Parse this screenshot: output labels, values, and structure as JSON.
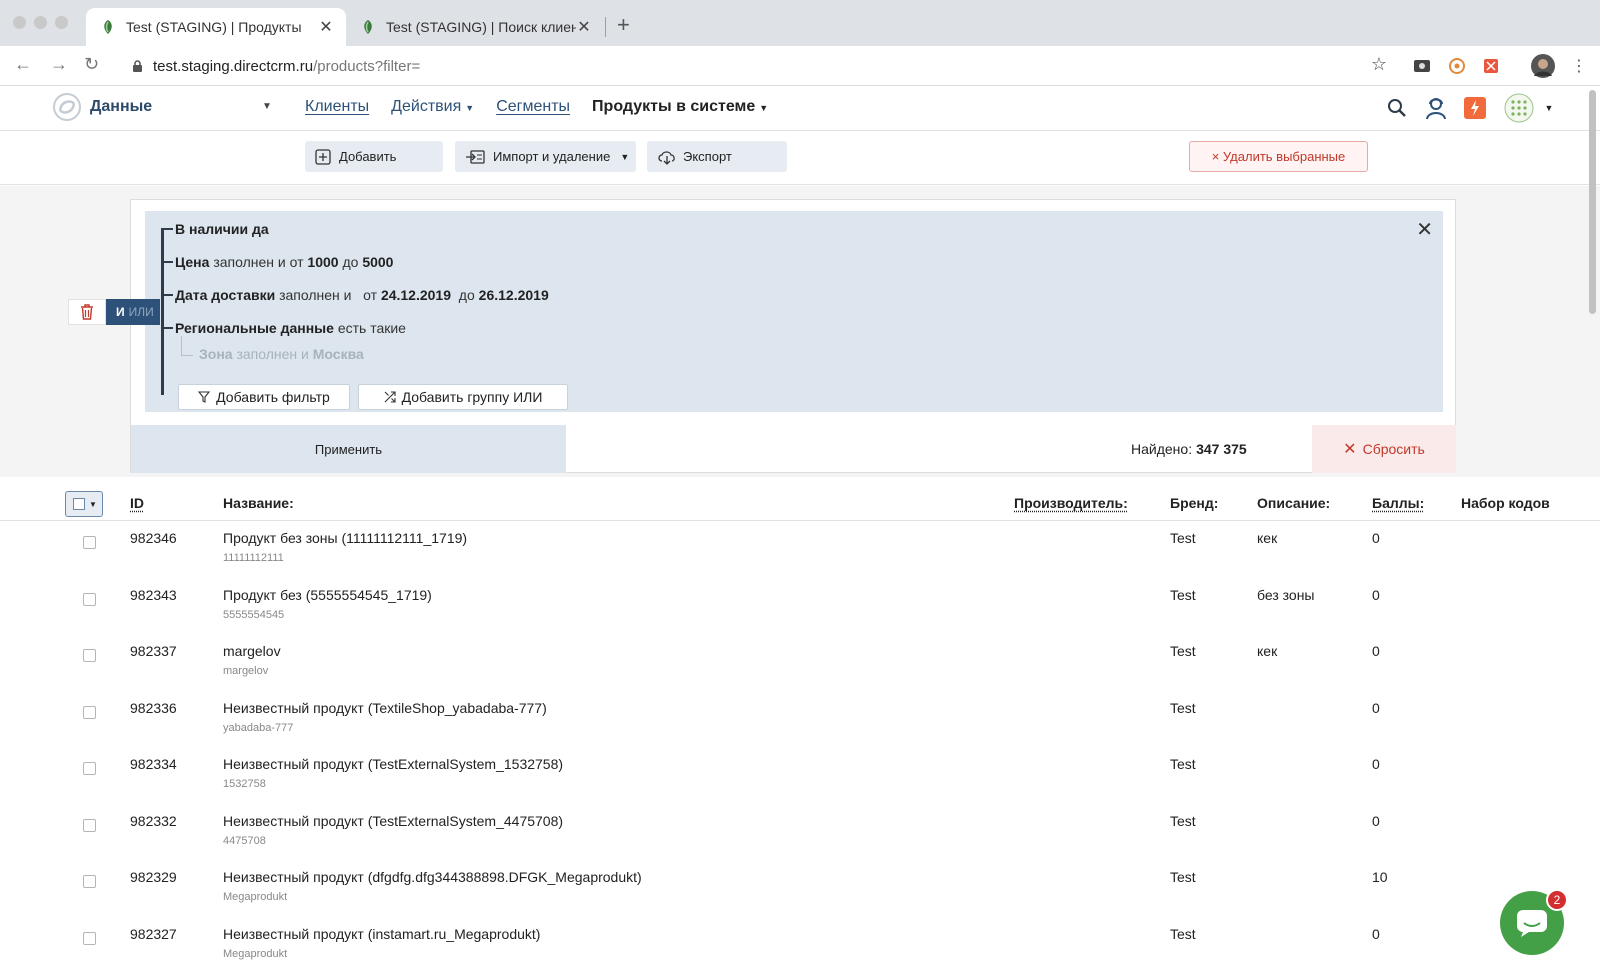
{
  "browser": {
    "tabs": [
      {
        "title": "Test (STAGING) | Продукты",
        "active": true
      },
      {
        "title": "Test (STAGING) | Поиск клиен",
        "active": false
      }
    ],
    "url_host": "test.staging.directcrm.ru",
    "url_path": "/products?filter="
  },
  "header": {
    "brand": "Данные",
    "nav": [
      {
        "label": "Клиенты",
        "kind": "link"
      },
      {
        "label": "Действия",
        "kind": "dropdown"
      },
      {
        "label": "Сегменты",
        "kind": "link"
      },
      {
        "label": "Продукты в системе",
        "kind": "current"
      }
    ],
    "icons": [
      "search-icon",
      "user-support-icon",
      "lightning-icon",
      "apps-grid-icon"
    ]
  },
  "toolbar": {
    "add_label": "Добавить",
    "import_label": "Импорт и удаление",
    "export_label": "Экспорт",
    "delete_selected_label": "× Удалить выбранные"
  },
  "filter": {
    "and_label": "И",
    "or_label": "ИЛИ",
    "rows": [
      {
        "field": "В наличии",
        "op": "",
        "value": "да"
      },
      {
        "field": "Цена",
        "op": "заполнен и  от",
        "value": "1000",
        "op2": "до",
        "value2": "5000"
      },
      {
        "field": "Дата доставки",
        "op": "заполнен и   от",
        "value": "24.12.2019",
        "op2": "до",
        "value2": "26.12.2019"
      },
      {
        "field": "Региональные данные",
        "op": "есть такие",
        "value": ""
      }
    ],
    "subrow": {
      "field": "Зона",
      "op": "заполнен и",
      "value": "Москва"
    },
    "add_filter_label": "Добавить фильтр",
    "add_or_group_label": "Добавить группу ИЛИ",
    "apply_label": "Применить",
    "found_label": "Найдено:",
    "found_count": "347 375",
    "reset_label": "Сбросить"
  },
  "table": {
    "columns": {
      "id": "ID",
      "name": "Название:",
      "manufacturer": "Производитель:",
      "brand": "Бренд:",
      "description": "Описание:",
      "points": "Баллы:",
      "codes": "Набор кодов"
    },
    "rows": [
      {
        "id": "982346",
        "name": "Продукт без зоны (11111112111_1719)",
        "sku": "11111112111",
        "brand": "Test",
        "description": "кек",
        "points": "0"
      },
      {
        "id": "982343",
        "name": "Продукт без (5555554545_1719)",
        "sku": "5555554545",
        "brand": "Test",
        "description": "без зоны",
        "points": "0"
      },
      {
        "id": "982337",
        "name": "margelov",
        "sku": "margelov",
        "brand": "Test",
        "description": "кек",
        "points": "0"
      },
      {
        "id": "982336",
        "name": "Неизвестный продукт (TextileShop_yabadaba-777)",
        "sku": "yabadaba-777",
        "brand": "Test",
        "description": "",
        "points": "0"
      },
      {
        "id": "982334",
        "name": "Неизвестный продукт (TestExternalSystem_1532758)",
        "sku": "1532758",
        "brand": "Test",
        "description": "",
        "points": "0"
      },
      {
        "id": "982332",
        "name": "Неизвестный продукт (TestExternalSystem_4475708)",
        "sku": "4475708",
        "brand": "Test",
        "description": "",
        "points": "0"
      },
      {
        "id": "982329",
        "name": "Неизвестный продукт (dfgdfg.dfg344388898.DFGK_Megaprodukt)",
        "sku": "Megaprodukt",
        "brand": "Test",
        "description": "",
        "points": "10"
      },
      {
        "id": "982327",
        "name": "Неизвестный продукт (instamart.ru_Megaprodukt)",
        "sku": "Megaprodukt",
        "brand": "Test",
        "description": "",
        "points": "0"
      }
    ]
  },
  "chat": {
    "badge": "2"
  },
  "colors": {
    "accent": "#2d5179",
    "danger": "#c0392b",
    "filter_bg": "#dde6ee",
    "chat": "#43a047"
  }
}
